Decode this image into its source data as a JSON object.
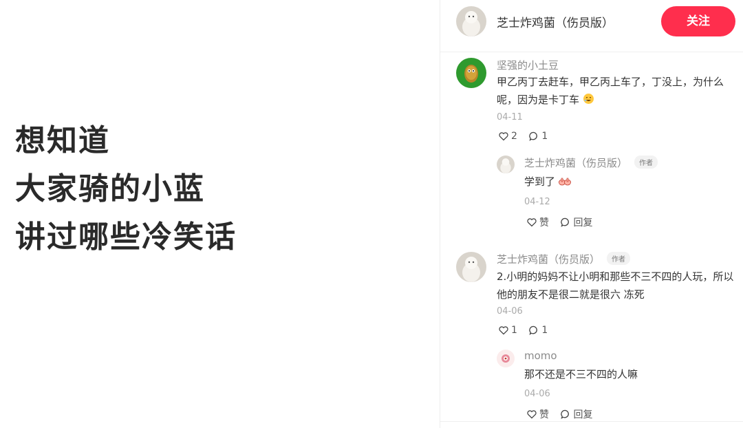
{
  "headline": {
    "lines": [
      "想知道",
      "大家骑的小蓝",
      "讲过哪些冷笑话"
    ]
  },
  "author_header": {
    "name": "芝士炸鸡菌（伤员版）",
    "follow_label": "关注"
  },
  "comments": [
    {
      "user": "坚强的小土豆",
      "text": "甲乙丙丁去赶车，甲乙丙上车了，丁没上，为什么呢，因为是卡丁车",
      "date": "04-11",
      "likes": "2",
      "replies_count": "1",
      "reply": {
        "user": "芝士炸鸡菌（伤员版）",
        "badge": "作者",
        "text": "学到了",
        "date": "04-12",
        "like_label": "赞",
        "reply_label": "回复"
      }
    },
    {
      "user": "芝士炸鸡菌（伤员版）",
      "badge": "作者",
      "text": "2.小明的妈妈不让小明和那些不三不四的人玩，所以他的朋友不是很二就是很六 冻死",
      "date": "04-06",
      "likes": "1",
      "replies_count": "1",
      "reply": {
        "user": "momo",
        "text": "那不还是不三不四的人嘛",
        "date": "04-06",
        "like_label": "赞",
        "reply_label": "回复"
      }
    }
  ],
  "colors": {
    "accent": "#ff2e4d",
    "muted_text": "#8a8a8a"
  }
}
